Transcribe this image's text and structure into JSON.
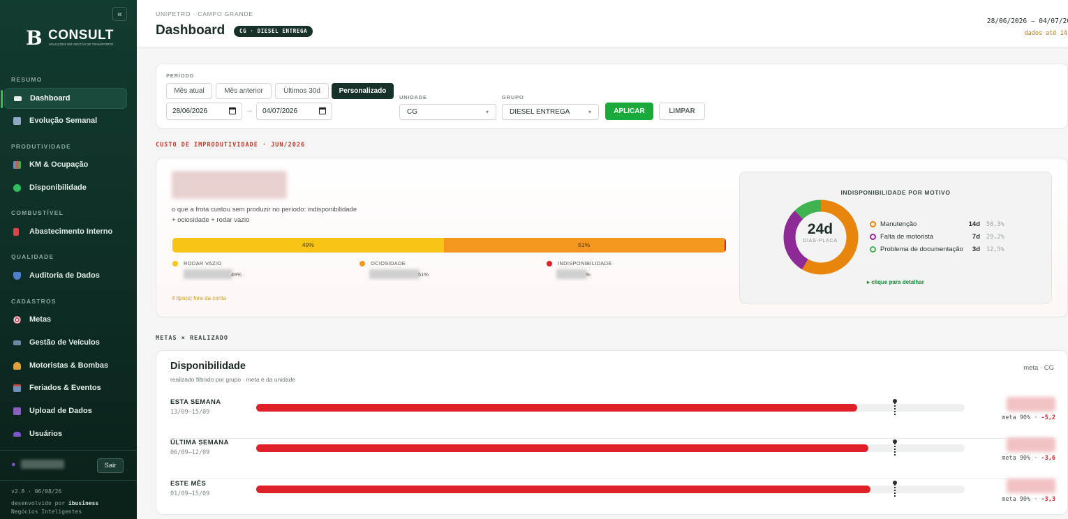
{
  "sidebar": {
    "logo_mark": "B",
    "logo_text": "CONSULT",
    "logo_sub": "SOLUÇÕES EM GESTÃO DE TRANSPORTE",
    "sections": {
      "resumo": "RESUMO",
      "produtividade": "PRODUTIVIDADE",
      "combustivel": "COMBUSTÍVEL",
      "qualidade": "QUALIDADE",
      "cadastros": "CADASTROS"
    },
    "items": [
      {
        "label": "Dashboard",
        "icon": "dashboard-icon",
        "color": "#e8f0ec"
      },
      {
        "label": "Evolução Semanal",
        "icon": "chart-line-icon",
        "color": "#8fa8c6"
      },
      {
        "label": "KM & Ocupação",
        "icon": "bar-chart-icon",
        "color": "#6f8fb8"
      },
      {
        "label": "Disponibilidade",
        "icon": "green-circle-icon",
        "color": "#2fbf5f"
      },
      {
        "label": "Abastecimento Interno",
        "icon": "fuel-pump-icon",
        "color": "#d94848"
      },
      {
        "label": "Auditoria de Dados",
        "icon": "shield-icon",
        "color": "#4f7ecb"
      },
      {
        "label": "Metas",
        "icon": "target-icon",
        "color": "#d24d5a"
      },
      {
        "label": "Gestão de Veículos",
        "icon": "truck-icon",
        "color": "#6a8aa8"
      },
      {
        "label": "Motoristas & Bombas",
        "icon": "person-icon",
        "color": "#e0a13a"
      },
      {
        "label": "Feriados & Eventos",
        "icon": "calendar-icon",
        "color": "#6f8fb8"
      },
      {
        "label": "Upload de Dados",
        "icon": "inbox-icon",
        "color": "#8b5fbf"
      },
      {
        "label": "Usuários",
        "icon": "users-icon",
        "color": "#7d56c9"
      }
    ],
    "logout": "Sair",
    "version": "v2.8 · 06/08/26",
    "dev_prefix": "desenvolvido por",
    "dev_company": "ibusiness",
    "dev_tagline": "Negócios Inteligentes",
    "collapse_glyph": "«"
  },
  "header": {
    "breadcrumb": "UNIPETRO · CAMPO GRANDE",
    "title": "Dashboard",
    "badge": "CG · DIESEL ENTREGA",
    "date_range": "28/06/2026 – 04/07/20",
    "data_until": "dados até 14/"
  },
  "filters": {
    "periodo_label": "PERÍODO",
    "chips": [
      "Mês atual",
      "Mês anterior",
      "Últimos 30d",
      "Personalizado"
    ],
    "active_chip": "Personalizado",
    "date_from": "28/06/2026",
    "date_to": "04/07/2026",
    "arrow": "→",
    "unidade_label": "UNIDADE",
    "unidade_value": "CG",
    "grupo_label": "GRUPO",
    "grupo_value": "DIESEL ENTREGA",
    "apply": "APLICAR",
    "clear": "LIMPAR"
  },
  "cost": {
    "section_title": "CUSTO DE IMPRODUTIVIDADE · JUN/2026",
    "description_line1": "o que a frota custou sem produzir no período: indisponibilidade",
    "description_line2": "+ ociosidade + rodar vazio",
    "bar": [
      {
        "name": "RODAR VAZIO",
        "pct": 49,
        "label": "49%",
        "color": "#f9c515"
      },
      {
        "name": "OCIOSIDADE",
        "pct": 50.7,
        "label": "51%",
        "color": "#f4961f"
      },
      {
        "name": "INDISPONIBILIDADE",
        "pct": 0.3,
        "label": "",
        "color": "#e02028"
      }
    ],
    "legend_pcts": [
      "49%",
      "51%",
      "%"
    ],
    "fora_note": "4 tipo(s) fora da conta",
    "donut": {
      "title": "INDISPONIBILIDADE POR MOTIVO",
      "total": "24d",
      "total_label": "DIAS-PLACA",
      "motivos": [
        {
          "label": "Manutenção",
          "days": "14d",
          "pct": "58,3%",
          "value": 58.3,
          "color": "#e7850c"
        },
        {
          "label": "Falta de motorista",
          "days": "7d",
          "pct": "29,2%",
          "value": 29.2,
          "color": "#8e2a96"
        },
        {
          "label": "Problema de documentação",
          "days": "3d",
          "pct": "12,5%",
          "value": 12.5,
          "color": "#3fb34f"
        }
      ],
      "detail_link": "▸ clique para detalhar"
    }
  },
  "goals": {
    "section_title": "METAS × REALIZADO",
    "card_title": "Disponibilidade",
    "card_sub": "realizado filtrado por grupo · meta é da unidade",
    "meta_unit": "meta · CG",
    "target_pct": 90,
    "rows": [
      {
        "label": "ESTA SEMANA",
        "dates": "13/09–15/09",
        "realized_pct": 84.8,
        "meta_text": "meta 90% · ",
        "delta": "-5,2"
      },
      {
        "label": "ÚLTIMA SEMANA",
        "dates": "06/09–12/09",
        "realized_pct": 86.4,
        "meta_text": "meta 90% · ",
        "delta": "-3,6"
      },
      {
        "label": "ESTE MÊS",
        "dates": "01/09–15/09",
        "realized_pct": 86.7,
        "meta_text": "meta 90% · ",
        "delta": "-3,3"
      }
    ]
  }
}
